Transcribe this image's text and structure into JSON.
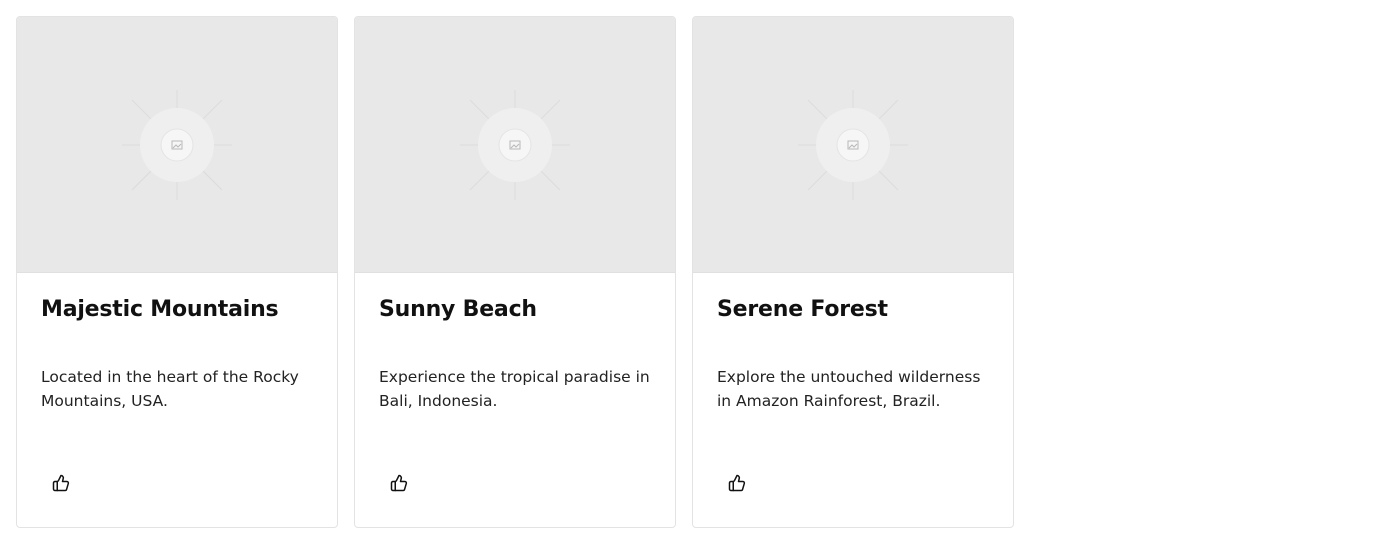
{
  "cards": [
    {
      "title": "Majestic Mountains",
      "description": "Located in the heart of the Rocky Mountains, USA.",
      "image_icon": "image-placeholder-icon",
      "action_icon": "thumbs-up-icon"
    },
    {
      "title": "Sunny Beach",
      "description": "Experience the tropical paradise in Bali, Indonesia.",
      "image_icon": "image-placeholder-icon",
      "action_icon": "thumbs-up-icon"
    },
    {
      "title": "Serene Forest",
      "description": "Explore the untouched wilderness in Amazon Rainforest, Brazil.",
      "image_icon": "image-placeholder-icon",
      "action_icon": "thumbs-up-icon"
    }
  ],
  "colors": {
    "placeholder_bg": "#e8e8e8",
    "card_border": "#e3e3e3",
    "text": "#111111"
  }
}
